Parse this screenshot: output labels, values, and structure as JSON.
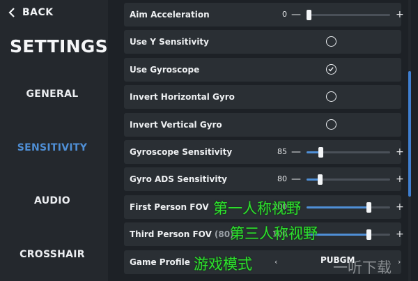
{
  "sidebar": {
    "back_label": "BACK",
    "title": "SETTINGS",
    "nav": [
      {
        "label": "GENERAL",
        "active": false
      },
      {
        "label": "SENSITIVITY",
        "active": true
      },
      {
        "label": "AUDIO",
        "active": false
      },
      {
        "label": "CROSSHAIR",
        "active": false
      }
    ]
  },
  "settings": {
    "aim_acceleration": {
      "label": "Aim Acceleration",
      "value": "0",
      "fraction": 0.0
    },
    "use_y_sensitivity": {
      "label": "Use Y Sensitivity",
      "checked": false
    },
    "use_gyroscope": {
      "label": "Use Gyroscope",
      "checked": true
    },
    "invert_horizontal_gyro": {
      "label": "Invert Horizontal Gyro",
      "checked": false
    },
    "invert_vertical_gyro": {
      "label": "Invert Vertical Gyro",
      "checked": false
    },
    "gyroscope_sensitivity": {
      "label": "Gyroscope Sensitivity",
      "value": "85",
      "fraction": 0.17
    },
    "gyro_ads_sensitivity": {
      "label": "Gyro ADS Sensitivity",
      "value": "80",
      "fraction": 0.16
    },
    "first_person_fov": {
      "label": "First Person FOV",
      "value": "100",
      "fraction": 0.74
    },
    "third_person_fov": {
      "label": "Third Person FOV",
      "default_hint": "(80)",
      "value": "100",
      "fraction": 0.74
    },
    "game_profile": {
      "label": "Game Profile",
      "value": "PUBGM"
    }
  },
  "controls": {
    "minus": "—",
    "plus": "+",
    "prev": "‹",
    "next": "›"
  },
  "overlays": {
    "first_person": "第一人称视野",
    "third_person": "第三人称视野",
    "game_mode": "游戏模式",
    "watermark": "一听下载"
  },
  "colors": {
    "accent": "#4f8fd6",
    "overlay_text": "#2ee02e"
  },
  "icons": {
    "back": "chevron-left-icon",
    "check": "check-icon"
  }
}
